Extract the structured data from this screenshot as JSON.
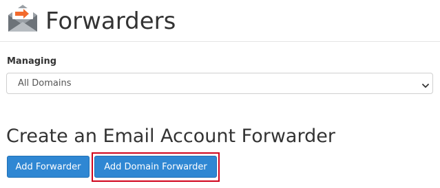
{
  "header": {
    "title": "Forwarders",
    "icon": "envelope-forward-icon"
  },
  "managing": {
    "label": "Managing",
    "selected": "All Domains"
  },
  "section": {
    "heading": "Create an Email Account Forwarder"
  },
  "buttons": {
    "add_forwarder": "Add Forwarder",
    "add_domain_forwarder": "Add Domain Forwarder"
  },
  "colors": {
    "button_primary": "#2f87d3",
    "highlight": "#d0021b",
    "icon_accent": "#f26a2c"
  }
}
